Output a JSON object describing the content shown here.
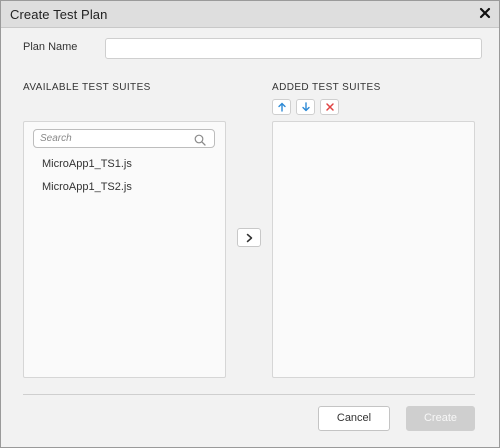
{
  "dialog": {
    "title": "Create Test Plan",
    "close_icon": "close-icon"
  },
  "plan_name": {
    "label": "Plan Name",
    "value": "",
    "placeholder": ""
  },
  "available": {
    "heading": "AVAILABLE TEST SUITES",
    "search_placeholder": "Search",
    "search_icon": "search-icon",
    "items": [
      "MicroApp1_TS1.js",
      "MicroApp1_TS2.js"
    ]
  },
  "added": {
    "heading": "ADDED TEST SUITES",
    "controls": {
      "move_up_icon": "arrow-up-icon",
      "move_down_icon": "arrow-down-icon",
      "remove_icon": "remove-icon"
    },
    "items": []
  },
  "transfer": {
    "icon": "chevron-right-icon"
  },
  "footer": {
    "cancel_label": "Cancel",
    "create_label": "Create"
  },
  "colors": {
    "accent_blue": "#2d8ad6",
    "remove_red": "#e04444",
    "disabled_button": "#cfcfcf"
  }
}
